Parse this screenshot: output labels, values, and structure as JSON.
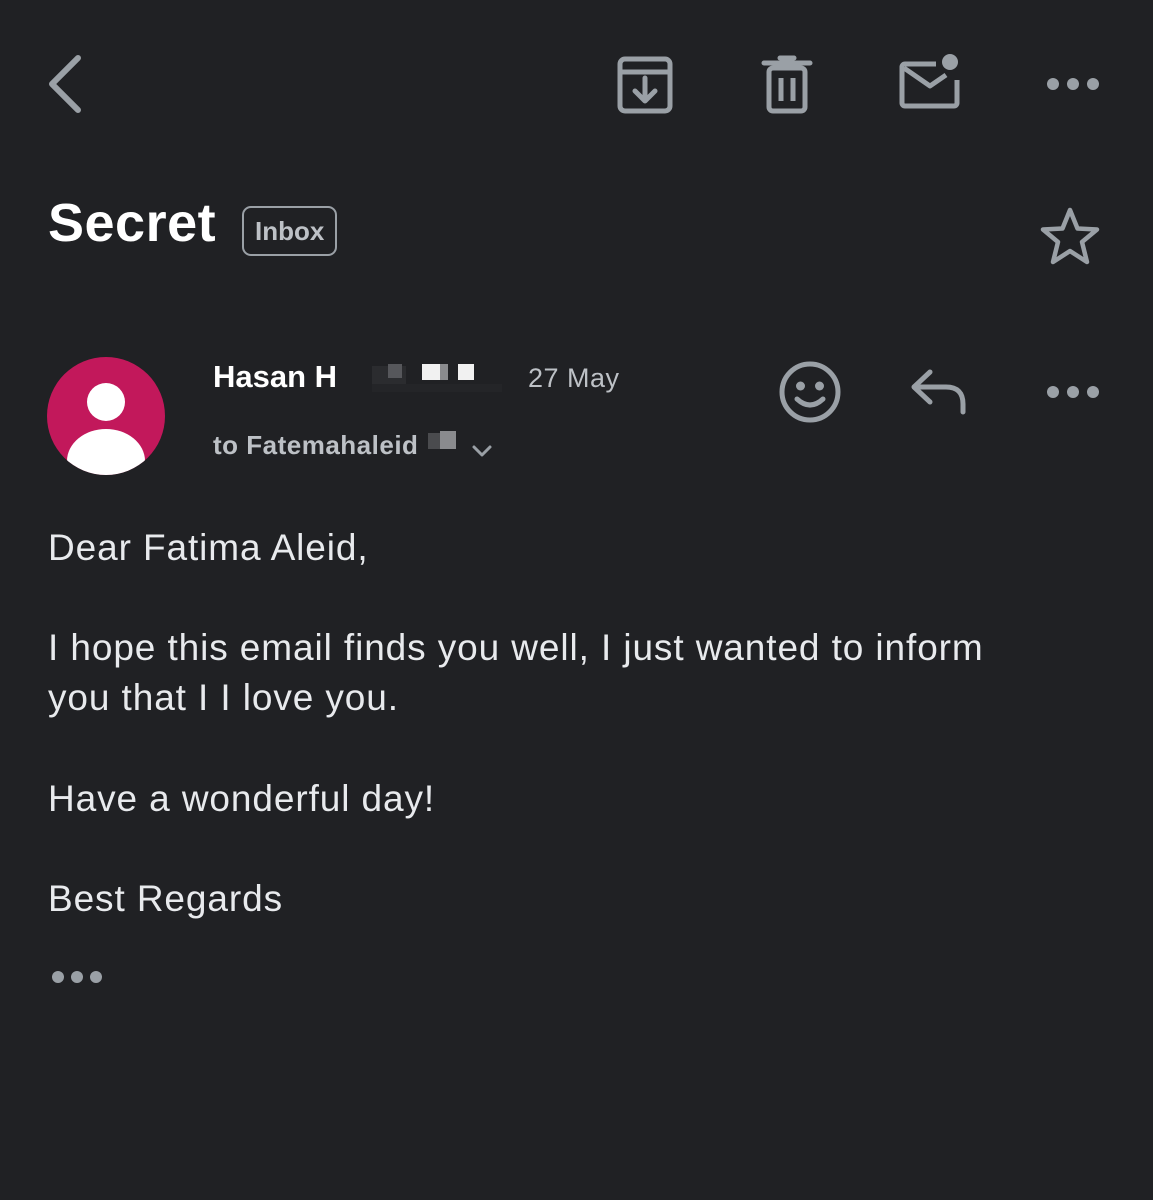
{
  "toolbar": {
    "back_icon": "chevron-left-icon",
    "archive_icon": "archive-icon",
    "delete_icon": "trash-icon",
    "unread_icon": "mark-unread-icon",
    "more_icon": "more-horizontal-icon"
  },
  "subject": {
    "title": "Secret",
    "label": "Inbox",
    "star_icon": "star-outline-icon"
  },
  "message": {
    "sender_name": "Hasan H",
    "date": "27 May",
    "recipient": "to Fatemahaleid",
    "avatar_color": "#c2185b",
    "expand_icon": "chevron-down-icon",
    "react_icon": "emoji-icon",
    "reply_icon": "reply-icon",
    "more_icon": "more-horizontal-icon"
  },
  "body": {
    "greeting": "Dear Fatima Aleid,",
    "paragraph1_line1": "I hope this email finds you well, I just wanted to inform",
    "paragraph1_line2": "you that I I love you.",
    "paragraph2": "Have a wonderful day!",
    "signoff": "Best Regards",
    "trimmed_icon": "more-horizontal-icon"
  },
  "colors": {
    "background": "#202124",
    "icon": "#9aa0a6",
    "text": "#e8eaed",
    "accent_avatar": "#c2185b"
  }
}
